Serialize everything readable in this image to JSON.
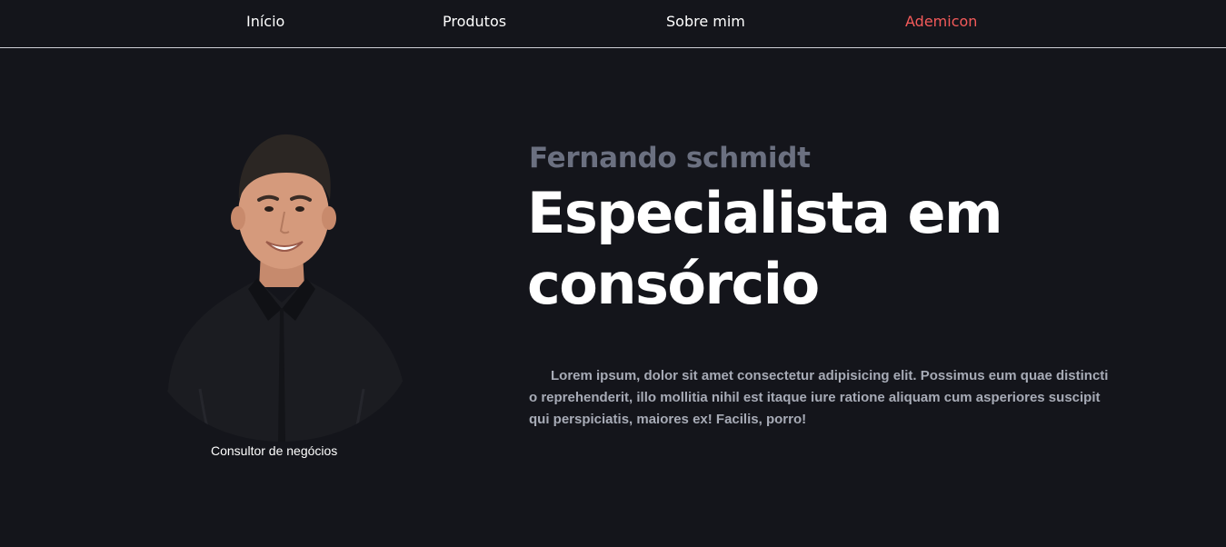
{
  "nav": {
    "items": [
      {
        "label": "Início"
      },
      {
        "label": "Produtos"
      },
      {
        "label": "Sobre mim"
      },
      {
        "label": "Ademicon"
      }
    ]
  },
  "profile": {
    "caption": "Consultor de negócios"
  },
  "hero": {
    "name": "Fernando schmidt",
    "headline": "Especialista em consórcio",
    "description": "Lorem ipsum, dolor sit amet consectetur adipisicing elit. Possimus eum quae distincti o reprehenderit, illo mollitia nihil est itaque iure ratione aliquam cum asperiores suscipit qui perspiciatis, maiores ex! Facilis, porro!"
  },
  "colors": {
    "background": "#14151b",
    "accent": "#f45a5a",
    "name_gray": "#6b7080",
    "body_gray": "#a7abb6"
  }
}
